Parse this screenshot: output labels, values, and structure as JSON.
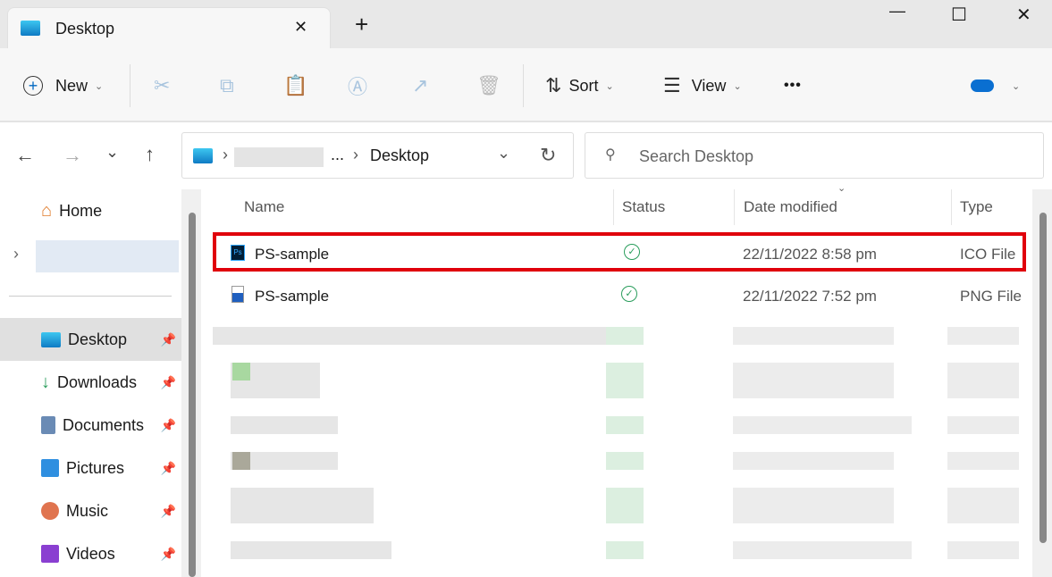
{
  "tab": {
    "title": "Desktop",
    "close": "✕",
    "new_tab": "+"
  },
  "window": {
    "minimize": "—",
    "maximize": "☐",
    "close": "✕"
  },
  "toolbar": {
    "new_label": "New",
    "sort_label": "Sort",
    "view_label": "View",
    "more": "•••"
  },
  "nav": {
    "back": "←",
    "forward": "→",
    "recent": "⌄",
    "up": "↑"
  },
  "address": {
    "ellipsis": "...",
    "current": "Desktop",
    "sep": "›"
  },
  "search": {
    "placeholder": "Search Desktop"
  },
  "sidebar": {
    "home": "Home",
    "items": [
      {
        "label": "Desktop",
        "icon": "desktop-icon"
      },
      {
        "label": "Downloads",
        "icon": "download-icon"
      },
      {
        "label": "Documents",
        "icon": "documents-icon"
      },
      {
        "label": "Pictures",
        "icon": "pictures-icon"
      },
      {
        "label": "Music",
        "icon": "music-icon"
      },
      {
        "label": "Videos",
        "icon": "videos-icon"
      }
    ]
  },
  "columns": {
    "name": "Name",
    "status": "Status",
    "date": "Date modified",
    "type": "Type"
  },
  "files": [
    {
      "name": "PS-sample",
      "status": "✓",
      "date": "22/11/2022 8:58 pm",
      "type": "ICO File"
    },
    {
      "name": "PS-sample",
      "status": "✓",
      "date": "22/11/2022 7:52 pm",
      "type": "PNG File"
    }
  ],
  "colors": {
    "highlight": "#e0000b",
    "accent": "#0067c0"
  }
}
